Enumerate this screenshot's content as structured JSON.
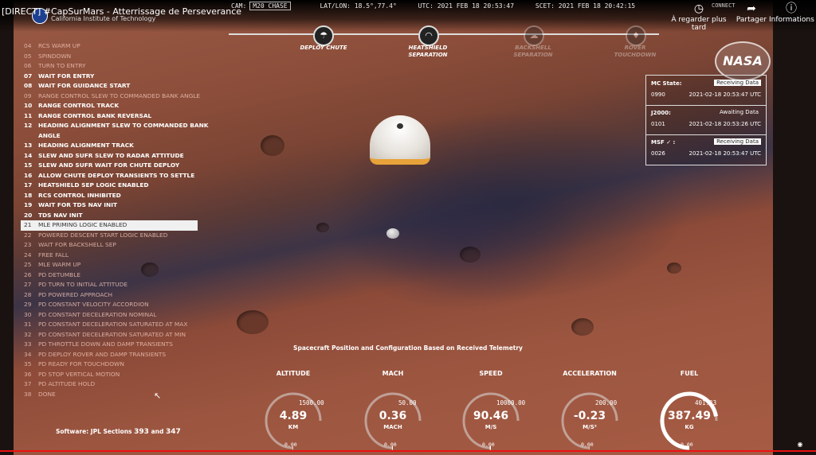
{
  "youtube": {
    "title": "[DIRECT] #CapSurMars - Atterrissage de Perseverance",
    "channel_sub": "California Institute of Technology",
    "watch_later": "À regarder plus tard",
    "share": "Partager",
    "info": "Informations",
    "connect": "CONNECT"
  },
  "hud": {
    "cam_label": "CAM:",
    "cam_value": "M20 CHASE",
    "latlon_label": "LAT/LON:",
    "latlon_value": "18.5°,77.4°",
    "utc_label": "UTC:",
    "utc_value": "2021 FEB 18 20:53:47",
    "scet_label": "SCET:",
    "scet_value": "2021 FEB 18 20:42:15"
  },
  "timeline": [
    {
      "label": "DEPLOY CHUTE",
      "icon": "parachute-icon",
      "state": "done"
    },
    {
      "label": "HEATSHIELD SEPARATION",
      "icon": "heatshield-icon",
      "state": "done"
    },
    {
      "label": "BACKSHELL SEPARATION",
      "icon": "backshell-icon",
      "state": "pending"
    },
    {
      "label": "ROVER TOUCHDOWN",
      "icon": "rover-icon",
      "state": "pending"
    }
  ],
  "nasa_logo": "NASA",
  "telemetry_status": {
    "mc": {
      "name": "MC State:",
      "status": "Receiving Data",
      "code": "0990",
      "time": "2021-02-18 20:53:47 UTC"
    },
    "j2000": {
      "name": "J2000:",
      "status": "Awaiting Data",
      "code": "0101",
      "time": "2021-02-18 20:53:26 UTC"
    },
    "msf": {
      "name": "MSF",
      "check": "✓ :",
      "status": "Receiving Data",
      "code": "0026",
      "time": "2021-02-18 20:53:47 UTC"
    }
  },
  "events": [
    {
      "n": "04",
      "t": "RCS WARM UP",
      "s": "pending"
    },
    {
      "n": "05",
      "t": "SPINDOWN",
      "s": "pending"
    },
    {
      "n": "06",
      "t": "TURN TO ENTRY",
      "s": "pending"
    },
    {
      "n": "07",
      "t": "WAIT FOR ENTRY",
      "s": "done"
    },
    {
      "n": "08",
      "t": "WAIT FOR GUIDANCE START",
      "s": "done"
    },
    {
      "n": "09",
      "t": "RANGE CONTROL SLEW TO COMMANDED BANK ANGLE",
      "s": "pending"
    },
    {
      "n": "10",
      "t": "RANGE CONTROL TRACK",
      "s": "done"
    },
    {
      "n": "11",
      "t": "RANGE CONTROL BANK REVERSAL",
      "s": "done"
    },
    {
      "n": "12",
      "t": "HEADING ALIGNMENT SLEW TO COMMANDED BANK",
      "s": "done"
    },
    {
      "n": "",
      "t": "ANGLE",
      "s": "done"
    },
    {
      "n": "13",
      "t": "HEADING ALIGNMENT TRACK",
      "s": "done"
    },
    {
      "n": "14",
      "t": "SLEW AND SUFR SLEW TO RADAR ATTITUDE",
      "s": "done"
    },
    {
      "n": "15",
      "t": "SLEW AND SUFR WAIT FOR CHUTE DEPLOY",
      "s": "done"
    },
    {
      "n": "16",
      "t": "ALLOW CHUTE DEPLOY TRANSIENTS TO SETTLE",
      "s": "done"
    },
    {
      "n": "17",
      "t": "HEATSHIELD SEP LOGIC ENABLED",
      "s": "done"
    },
    {
      "n": "18",
      "t": "RCS CONTROL INHIBITED",
      "s": "done"
    },
    {
      "n": "19",
      "t": "WAIT FOR TDS NAV INIT",
      "s": "done"
    },
    {
      "n": "20",
      "t": "TDS NAV INIT",
      "s": "done"
    },
    {
      "n": "21",
      "t": "MLE PRIMING LOGIC ENABLED",
      "s": "active"
    },
    {
      "n": "22",
      "t": "POWERED DESCENT START LOGIC ENABLED",
      "s": "pending"
    },
    {
      "n": "23",
      "t": "WAIT FOR BACKSHELL SEP",
      "s": "pending"
    },
    {
      "n": "24",
      "t": "FREE FALL",
      "s": "pending"
    },
    {
      "n": "25",
      "t": "MLE WARM UP",
      "s": "pending"
    },
    {
      "n": "26",
      "t": "PD DETUMBLE",
      "s": "pending"
    },
    {
      "n": "27",
      "t": "PD TURN TO INITIAL ATTITUDE",
      "s": "pending"
    },
    {
      "n": "28",
      "t": "PD POWERED APPROACH",
      "s": "pending"
    },
    {
      "n": "29",
      "t": "PD CONSTANT VELOCITY ACCORDION",
      "s": "pending"
    },
    {
      "n": "30",
      "t": "PD CONSTANT DECELERATION NOMINAL",
      "s": "pending"
    },
    {
      "n": "31",
      "t": "PD CONSTANT DECELERATION SATURATED AT MAX",
      "s": "pending"
    },
    {
      "n": "32",
      "t": "PD CONSTANT DECELERATION SATURATED AT MIN",
      "s": "pending"
    },
    {
      "n": "33",
      "t": "PD THROTTLE DOWN AND DAMP TRANSIENTS",
      "s": "pending"
    },
    {
      "n": "34",
      "t": "PD DEPLOY ROVER AND DAMP TRANSIENTS",
      "s": "pending"
    },
    {
      "n": "35",
      "t": "PD READY FOR TOUCHDOWN",
      "s": "pending"
    },
    {
      "n": "36",
      "t": "PD STOP VERTICAL MOTION",
      "s": "pending"
    },
    {
      "n": "37",
      "t": "PD ALTITUDE HOLD",
      "s": "pending"
    },
    {
      "n": "38",
      "t": "DONE",
      "s": "pending"
    }
  ],
  "software": {
    "label": "Software: JPL Sections",
    "s1": "393",
    "and": "and",
    "s2": "347"
  },
  "gauge_caption": "Spacecraft Position and Configuration Based on Received Telemetry",
  "gauges": [
    {
      "label": "ALTITUDE",
      "value": "4.89",
      "unit": "KM",
      "max": "1500.00",
      "min": "0.00",
      "fraction": 0.003
    },
    {
      "label": "MACH",
      "value": "0.36",
      "unit": "MACH",
      "max": "50.00",
      "min": "0.00",
      "fraction": 0.007
    },
    {
      "label": "SPEED",
      "value": "90.46",
      "unit": "M/S",
      "max": "10000.00",
      "min": "0.00",
      "fraction": 0.009
    },
    {
      "label": "ACCELERATION",
      "value": "-0.23",
      "unit": "M/S²",
      "max": "200.00",
      "min": "0.00",
      "fraction": 0.0
    },
    {
      "label": "FUEL",
      "value": "387.49",
      "unit": "KG",
      "max": "401.33",
      "min": "0.00",
      "fraction": 0.965
    }
  ],
  "colors": {
    "accent_active": "#f0f0f0",
    "chute_band": "#e8a23a",
    "progress": "#e11111"
  }
}
